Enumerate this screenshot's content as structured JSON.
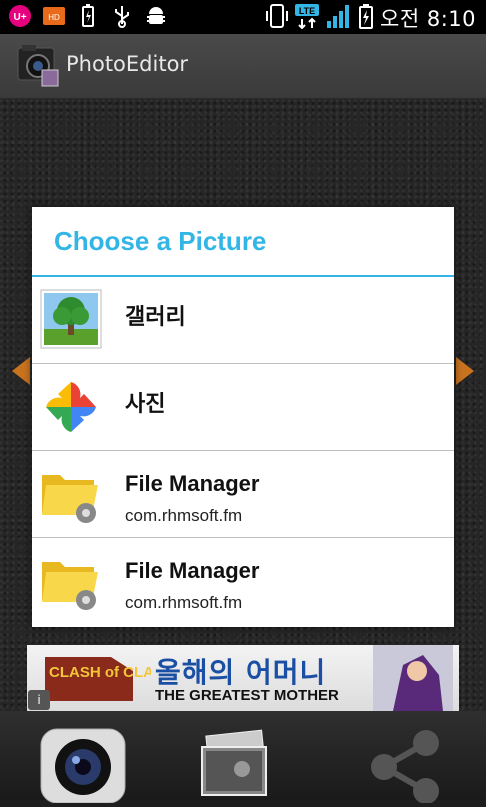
{
  "status_bar": {
    "time": "오전 8:10",
    "network": "LTE",
    "carrier_badge": "U+",
    "hd_badge": "HD"
  },
  "action_bar": {
    "title": "PhotoEditor"
  },
  "dialog": {
    "title": "Choose a Picture",
    "options": [
      {
        "label": "갤러리",
        "sublabel": "",
        "icon": "gallery-tree-icon"
      },
      {
        "label": "사진",
        "sublabel": "",
        "icon": "google-photos-icon"
      },
      {
        "label": "File Manager",
        "sublabel": "com.rhmsoft.fm",
        "icon": "folder-gear-icon"
      },
      {
        "label": "File Manager",
        "sublabel": "com.rhmsoft.fm",
        "icon": "folder-gear-icon"
      }
    ]
  },
  "ad": {
    "logo_text": "CLASH of CLANS",
    "headline": "올해의 어머니",
    "subline": "THE GREATEST MOTHER",
    "info": "i"
  },
  "colors": {
    "accent": "#33b5e5",
    "arrow": "#c9731f"
  }
}
